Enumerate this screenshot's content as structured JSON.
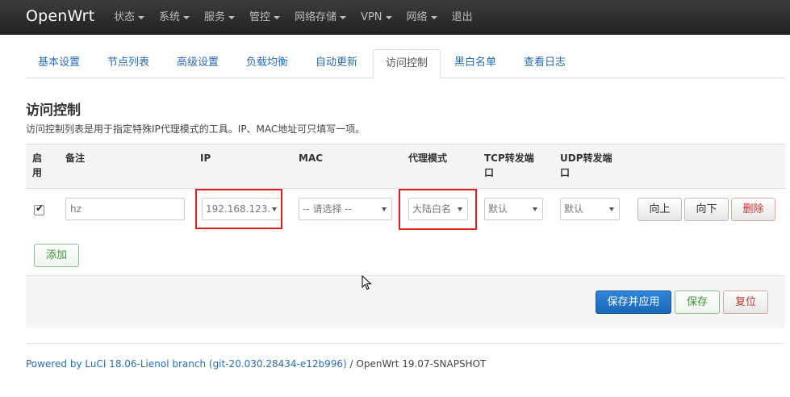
{
  "navbar": {
    "brand": "OpenWrt",
    "menu": [
      {
        "label": "状态",
        "caret": true
      },
      {
        "label": "系统",
        "caret": true
      },
      {
        "label": "服务",
        "caret": true
      },
      {
        "label": "管控",
        "caret": true
      },
      {
        "label": "网络存储",
        "caret": true
      },
      {
        "label": "VPN",
        "caret": true
      },
      {
        "label": "网络",
        "caret": true
      },
      {
        "label": "退出",
        "caret": false
      }
    ]
  },
  "tabs": [
    {
      "label": "基本设置",
      "active": false
    },
    {
      "label": "节点列表",
      "active": false
    },
    {
      "label": "高级设置",
      "active": false
    },
    {
      "label": "负载均衡",
      "active": false
    },
    {
      "label": "自动更新",
      "active": false
    },
    {
      "label": "访问控制",
      "active": true
    },
    {
      "label": "黑白名单",
      "active": false
    },
    {
      "label": "查看日志",
      "active": false
    }
  ],
  "section": {
    "title": "访问控制",
    "description": "访问控制列表是用于指定特殊IP代理模式的工具。IP、MAC地址可只填写一项。"
  },
  "table": {
    "headers": {
      "enabled": "启用",
      "remark": "备注",
      "ip": "IP",
      "mac": "MAC",
      "proxy_mode": "代理模式",
      "tcp_redir": "TCP转发端口",
      "udp_redir": "UDP转发端口"
    },
    "row": {
      "enabled": true,
      "remark": "hz",
      "ip": "192.168.123.",
      "mac": "-- 请选择 --",
      "proxy_mode": "大陆白名",
      "tcp_redir": "默认",
      "udp_redir": "默认",
      "btn_up": "向上",
      "btn_down": "向下",
      "btn_remove": "删除"
    },
    "add_label": "添加"
  },
  "actions": {
    "save_apply": "保存并应用",
    "save": "保存",
    "reset": "复位"
  },
  "footer": {
    "link_text": "Powered by LuCI 18.06-Lienol branch (git-20.030.28434-e12b996)",
    "suffix": " / OpenWrt 19.07-SNAPSHOT"
  },
  "colors": {
    "navbar_bg": "#222222",
    "link": "#2a6cb2",
    "highlight_box": "#e02020",
    "primary_button": "#1a66b9"
  }
}
